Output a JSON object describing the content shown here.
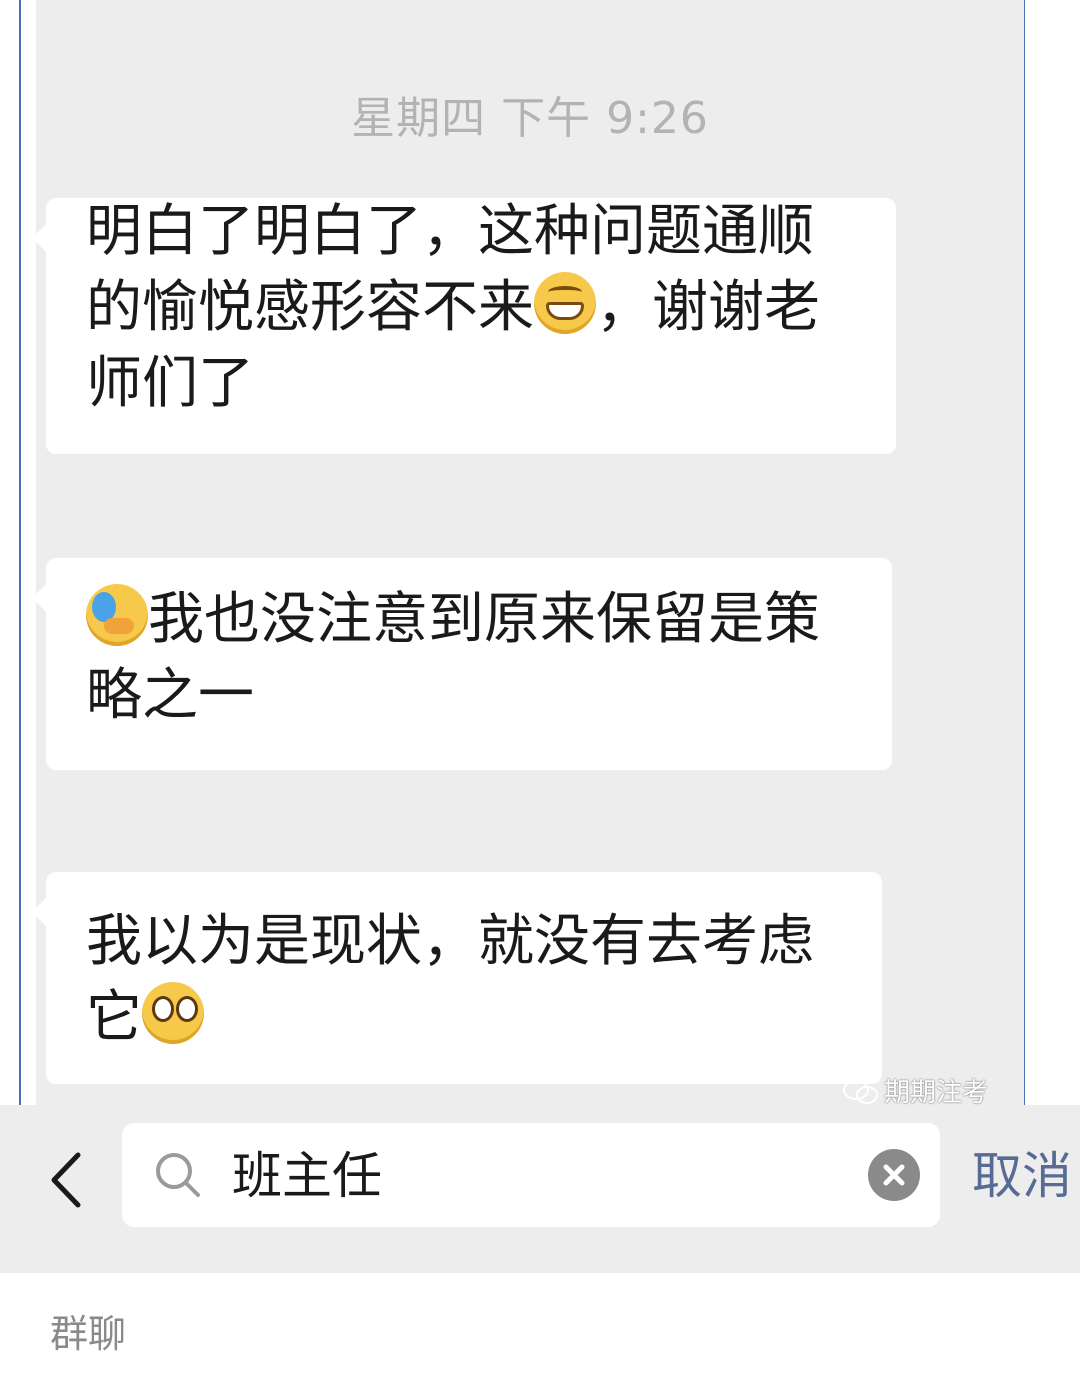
{
  "chat": {
    "timestamp": "星期四 下午 9:26",
    "messages": [
      {
        "text_before": "明白了明白了，这种问题通顺的愉悦感形容不来",
        "emoji": "grinning-face-icon",
        "text_after": "，谢谢老师们了"
      },
      {
        "emoji": "loudly-crying-face-icon",
        "text_after": "我也没注意到原来保留是策略之一"
      },
      {
        "text_before": "我以为是现状，就没有去考虑它",
        "emoji": "pleading-face-icon"
      }
    ],
    "watermark": "期期注考"
  },
  "search": {
    "back_icon": "chevron-left-icon",
    "search_icon": "search-icon",
    "query": "班主任",
    "clear_icon": "clear-icon",
    "cancel_label": "取消"
  },
  "results": {
    "section_label": "群聊"
  },
  "colors": {
    "chat_bg": "#ededed",
    "bubble_bg": "#ffffff",
    "link_blue": "#576b95",
    "timestamp_gray": "#b3b3b3"
  }
}
